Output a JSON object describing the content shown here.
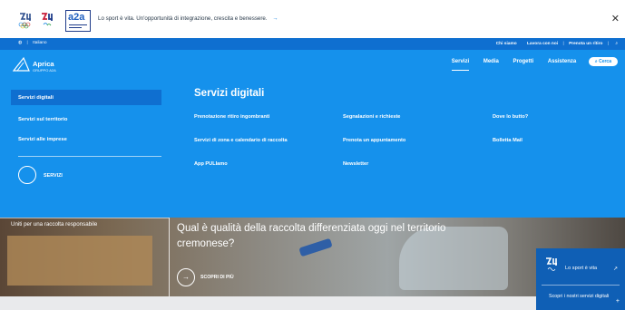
{
  "promo": {
    "text": "Lo sport è vita. Un'opportunità di integrazione, crescita e benessere.",
    "arrow": "→",
    "close": "✕",
    "logos": [
      "milano-cortina-olympic-logo",
      "milano-cortina-paralympic-logo",
      "a2a-logo"
    ],
    "a2a_text": "a2a"
  },
  "utilbar": {
    "language": "Italiano",
    "links": [
      "Chi siamo",
      "Lavora con noi",
      "Prenota un ritiro"
    ],
    "icons": [
      "globe-icon",
      "search-icon"
    ]
  },
  "nav": {
    "brand_name": "Aprica",
    "brand_sub": "GRUPPO A2A",
    "items": [
      "Servizi",
      "Media",
      "Progetti",
      "Assistenza"
    ],
    "active": "Servizi",
    "cerca": "Cerca",
    "cerca_icon": "search-icon"
  },
  "mega": {
    "sidebar": [
      "Servizi digitali",
      "Servizi sul territorio",
      "Servizi alle imprese"
    ],
    "sidebar_active": "Servizi digitali",
    "servizi_label": "SERVIZI",
    "title": "Servizi digitali",
    "links": {
      "col1": [
        "Prenotazione ritiro ingombranti",
        "Servizi di zona e calendario di raccolta",
        "App PULIamo"
      ],
      "col2": [
        "Segnalazioni e richieste",
        "Prenota un appuntamento",
        "Newsletter"
      ],
      "col3": [
        "Dove lo butto?",
        "Bolletta Mail"
      ]
    }
  },
  "hero": {
    "caption": "Uniti per una raccolta responsabile",
    "title": "Qual è qualità della raccolta differenziata oggi nel territorio cremonese?",
    "cta": "SCOPRI DI PIÙ",
    "cta_icon": "arrow-right-icon"
  },
  "floatcard": {
    "text": "Lo sport è vita",
    "arrow": "↗",
    "text2": "Scopri i nostri servizi digitali",
    "plus": "+"
  },
  "colors": {
    "primary": "#1591ec",
    "dark_blue": "#0f6fd0",
    "card_blue": "#0f5fb5"
  }
}
